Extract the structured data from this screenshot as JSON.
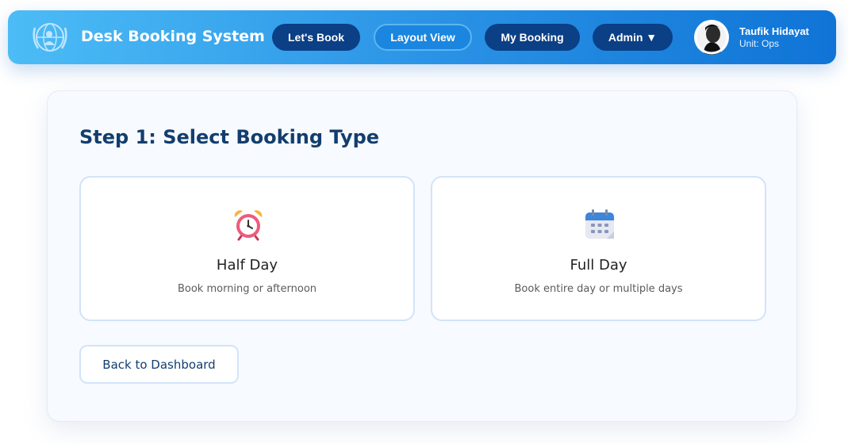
{
  "header": {
    "brand": "Desk Booking System",
    "nav": {
      "lets_book": "Let's Book",
      "layout_view": "Layout View",
      "my_booking": "My Booking",
      "admin": "Admin ▼"
    },
    "user": {
      "name": "Taufik Hidayat",
      "unit": "Unit: Ops"
    }
  },
  "main": {
    "step_title": "Step 1: Select Booking Type",
    "options": [
      {
        "icon": "alarm-clock-icon",
        "title": "Half Day",
        "description": "Book morning or afternoon"
      },
      {
        "icon": "calendar-icon",
        "title": "Full Day",
        "description": "Book entire day or multiple days"
      }
    ],
    "back_button": "Back to Dashboard"
  },
  "colors": {
    "nav_gradient_start": "#4cbcf6",
    "nav_gradient_end": "#0f74d6",
    "nav_button_dark": "#0b3f86",
    "nav_button_active": "#1a86e0",
    "heading": "#123e6e",
    "card_border": "#d3e3f8"
  }
}
